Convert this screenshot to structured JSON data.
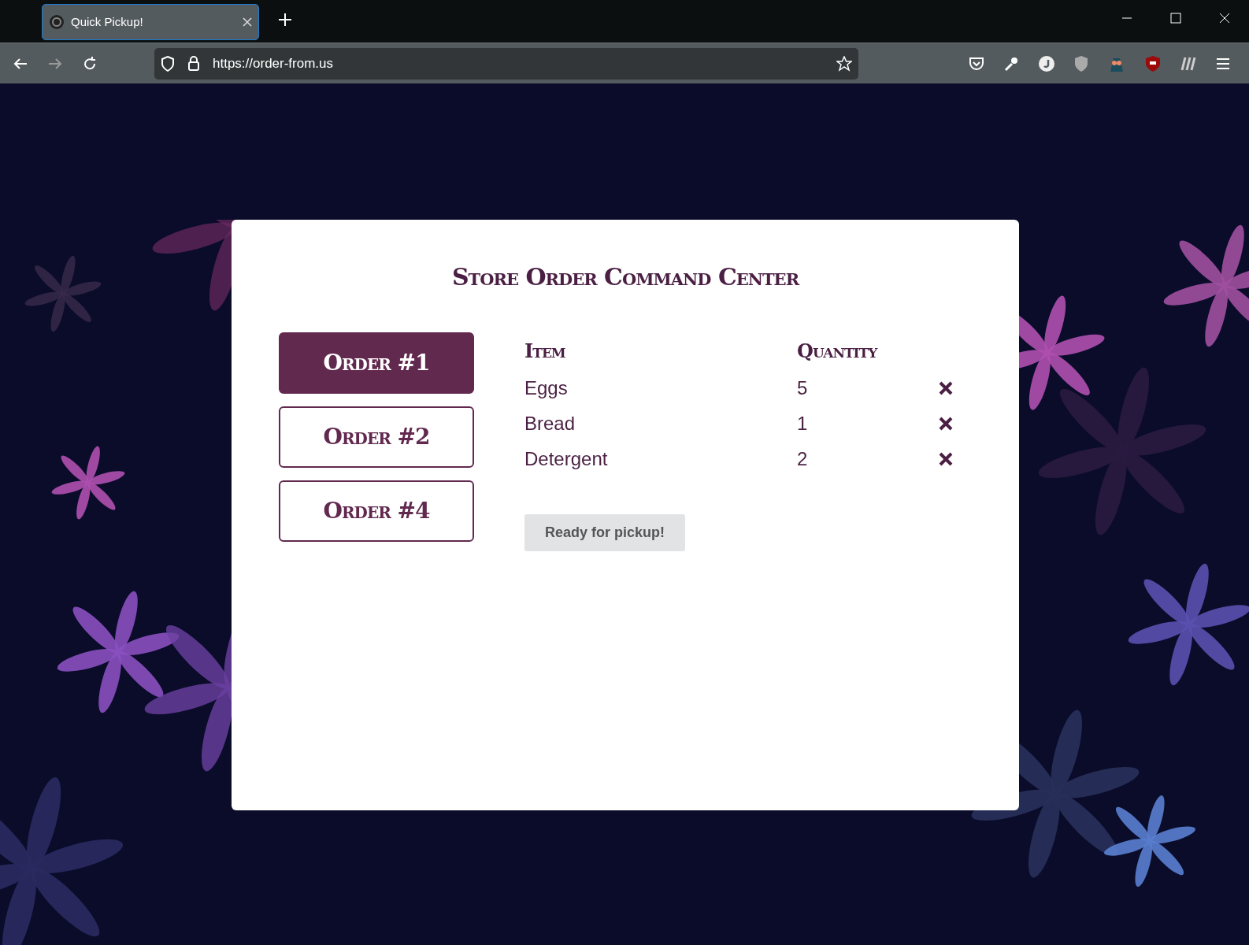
{
  "browser": {
    "tab_title": "Quick Pickup!",
    "url": "https://order-from.us"
  },
  "page": {
    "title": "Store Order Command Center",
    "orders": [
      {
        "label": "Order #1",
        "selected": true
      },
      {
        "label": "Order #2",
        "selected": false
      },
      {
        "label": "Order #4",
        "selected": false
      }
    ],
    "table": {
      "columns": [
        "Item",
        "Quantity"
      ],
      "rows": [
        {
          "item": "Eggs",
          "quantity": "5"
        },
        {
          "item": "Bread",
          "quantity": "1"
        },
        {
          "item": "Detergent",
          "quantity": "2"
        }
      ]
    },
    "action_button": "Ready for pickup!"
  }
}
